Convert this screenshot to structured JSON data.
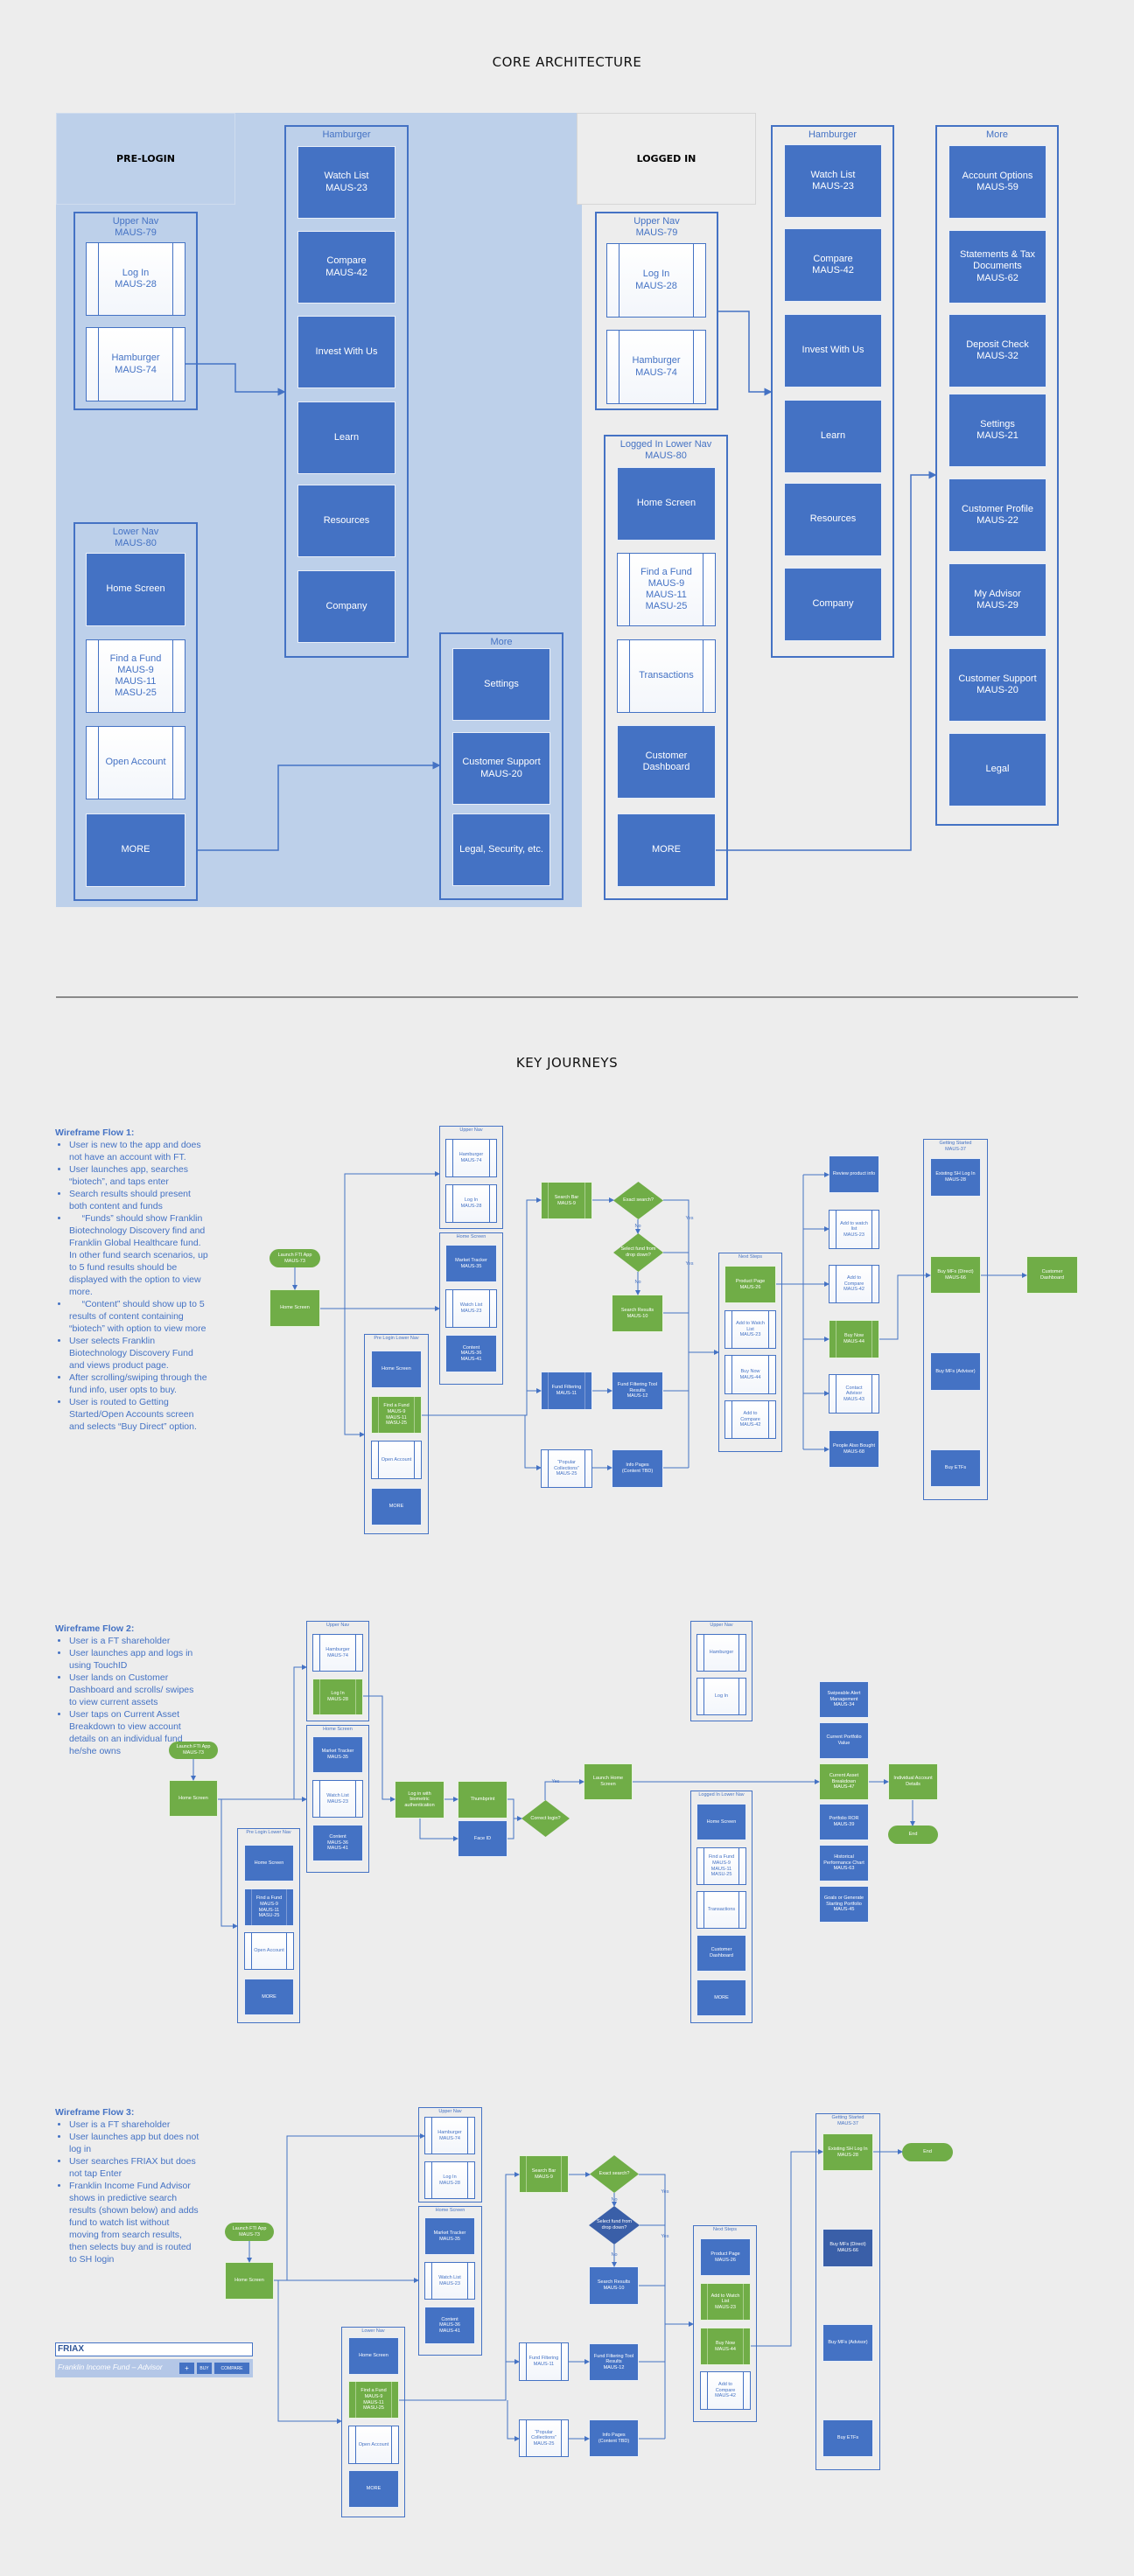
{
  "core": {
    "title": "CORE ARCHITECTURE",
    "pre_login": {
      "title": "PRE-LOGIN",
      "upper_nav": "Upper Nav\nMAUS-79",
      "log_in": "Log In\nMAUS-28",
      "hamburger_nav": "Hamburger\nMAUS-74",
      "hamburger": "Hamburger",
      "watch_list": "Watch List\nMAUS-23",
      "compare": "Compare\nMAUS-42",
      "invest": "Invest With Us",
      "learn": "Learn",
      "resources": "Resources",
      "company": "Company",
      "lower_nav": "Lower Nav\nMAUS-80",
      "home": "Home Screen",
      "find_fund": "Find a Fund\nMAUS-9\nMAUS-11\nMASU-25",
      "open_account": "Open Account",
      "more_btn": "MORE",
      "more": "More",
      "settings": "Settings",
      "support": "Customer Support\nMAUS-20",
      "legal": "Legal, Security, etc."
    },
    "logged_in": {
      "title": "LOGGED IN",
      "upper_nav": "Upper Nav\nMAUS-79",
      "log_in": "Log In\nMAUS-28",
      "hamburger_nav": "Hamburger\nMAUS-74",
      "lower_nav": "Logged In Lower Nav\nMAUS-80",
      "home": "Home Screen",
      "find_fund": "Find a Fund\nMAUS-9\nMAUS-11\nMASU-25",
      "transactions": "Transactions",
      "dashboard": "Customer\nDashboard",
      "more_btn": "MORE",
      "hamburger": "Hamburger",
      "watch_list": "Watch List\nMAUS-23",
      "compare": "Compare\nMAUS-42",
      "invest": "Invest With Us",
      "learn": "Learn",
      "resources": "Resources",
      "company": "Company",
      "more": "More",
      "account_options": "Account Options\nMAUS-59",
      "statements": "Statements & Tax\nDocuments\nMAUS-62",
      "deposit": "Deposit Check\nMAUS-32",
      "settings": "Settings\nMAUS-21",
      "profile": "Customer Profile\nMAUS-22",
      "advisor": "My Advisor\nMAUS-29",
      "support": "Customer Support\nMAUS-20",
      "legal": "Legal"
    }
  },
  "journeys": {
    "title": "KEY JOURNEYS",
    "flow1": {
      "heading": "Wireframe Flow 1:",
      "bullets": [
        "User is new to the app and does not have an account with FT.",
        "User launches app, searches “biotech”, and taps enter",
        "Search results should present both content and funds",
        "     “Funds” should show Franklin Biotechnology Discovery find and Franklin Global Healthcare fund.  In other fund search scenarios, up to 5 fund results should be displayed with the option to view more.",
        "     “Content” should show up to 5 results of content containing “biotech” with option to view more",
        "User selects Franklin Biotechnology Discovery Fund and views product page.",
        "After scrolling/swiping through the fund info, user opts to buy.",
        "User is routed to Getting Started/Open Accounts screen and selects “Buy Direct” option."
      ],
      "nodes": {
        "launch": "Launch FTI App\nMAUS-73",
        "home": "Home Screen",
        "upper_nav": "Upper Nav",
        "hamburger": "Hamburger\nMAUS-74",
        "log_in": "Log In\nMAUS-28",
        "home_group": "Home Screen",
        "market_tracker": "Market Tracker\nMAUS-35",
        "watch_list": "Watch List\nMAUS-23",
        "content": "Content\nMAUS-36\nMAUS-41",
        "lower_nav": "Pre Login Lower Nav",
        "lower_home": "Home Screen",
        "find_fund": "Find a Fund\nMAUS-9\nMAUS-11\nMASU-25",
        "open_account": "Open Account",
        "more": "MORE",
        "search_bar": "Search Bar\nMAUS-9",
        "exact": "Exact search?",
        "no1": "No",
        "select": "Select fund from\ndrop down?",
        "no2": "No",
        "search_results": "Search Results\nMAUS-10",
        "fund_filtering": "Fund Filtering\nMAUS-11",
        "fund_filtering_results": "Fund Filtering Tool\nResults\nMAUS-12",
        "popular": "“Popular\nCollections”\nMAUS-25",
        "info_pages": "Info Pages\n(Content TBD)",
        "yes1": "Yes",
        "yes2": "Yes",
        "next_steps": "Next Steps",
        "product_page": "Product Page\nMAUS-26",
        "ns_watch": "Add to Watch\nList\nMAUS-23",
        "ns_buy": "Buy Now\nMAUS-44",
        "ns_compare": "Add to\nCompare\nMAUS-42",
        "review": "Review product info",
        "add_watch": "Add to watch\nlist\nMAUS-23",
        "add_compare": "Add to\nCompare\nMAUS-42",
        "buy_now": "Buy Now\nMAUS-44",
        "contact_advisor": "Contact\nAdvisor\nMAUS-43",
        "people_bought": "People Also Bought\nMAUS-68",
        "getting_started": "Getting Started\nMAUS-37",
        "existing_login": "Existing SH Log In\nMAUS-28",
        "buy_direct": "Buy MFs (Direct)\nMAUS-66",
        "buy_advisor": "Buy MFs (Advisor)",
        "buy_etfs": "Buy ETFs",
        "dashboard": "Customer\nDashboard"
      }
    },
    "flow2": {
      "heading": "Wireframe Flow 2:",
      "bullets": [
        "User is a FT shareholder",
        "User launches app and logs in using TouchID",
        "User lands on Customer Dashboard and scrolls/ swipes to view current assets",
        "User taps on Current Asset Breakdown to view account details on an individual fund he/she owns"
      ],
      "nodes": {
        "launch": "Launch FTI App\nMAUS-73",
        "home": "Home Screen",
        "upper_nav": "Upper Nav",
        "hamburger": "Hamburger\nMAUS-74",
        "log_in": "Log In\nMAUS-28",
        "home_group": "Home Screen",
        "market_tracker": "Market Tracker\nMAUS-35",
        "watch_list": "Watch List\nMAUS-23",
        "content": "Content\nMAUS-36\nMAUS-41",
        "lower_nav": "Pre Login Lower Nav",
        "lower_home": "Home Screen",
        "find_fund": "Find a Fund\nMAUS-9\nMAUS-11\nMASU-25",
        "open_account": "Open Account",
        "more": "MORE",
        "biometric": "Log in with\nbiometric\nauthentication",
        "thumbprint": "Thumbprint",
        "face_id": "Face ID",
        "correct_login": "Correct login?",
        "yes": "Yes",
        "launch_home": "Launch Home\nScreen",
        "li_upper_nav": "Upper Nav",
        "li_hamburger": "Hamburger",
        "li_log_in": "Log In",
        "li_lower_nav": "Logged In Lower Nav",
        "li_home": "Home Screen",
        "li_find_fund": "Find a Fund\nMAUS-9\nMAUS-11\nMASU-25",
        "li_transactions": "Transactions",
        "li_dashboard": "Customer\nDashboard",
        "li_more": "MORE",
        "swipeable": "Swipeable Alert\nManagement\nMAUS-34",
        "portfolio_value": "Current Portfolio\nValue",
        "asset_breakdown": "Current Asset\nBreakdown\nMAUS-47",
        "portfolio_ror": "Portfolio ROR\nMAUS-39",
        "historical": "Historical\nPerformance Chart\nMAUS-63",
        "goals": "Goals or Generate\nStarting Portfolio\nMAUS-45",
        "account_details": "Individual Account\nDetails",
        "end": "End"
      }
    },
    "flow3": {
      "heading": "Wireframe Flow 3:",
      "bullets": [
        "User is a FT shareholder",
        "User launches app but does not log in",
        "User searches FRIAX but does not tap Enter",
        "Franklin Income Fund Advisor shows in predictive search results (shown below) and adds fund to watch list without moving from search results, then selects buy and is routed to SH login"
      ],
      "search_widget": {
        "query": "FRIAX",
        "result": "Franklin Income Fund – Advisor",
        "add_label": "+",
        "buy_label": "BUY",
        "compare_label": "COMPARE"
      },
      "nodes": {
        "launch": "Launch FTI App\nMAUS-73",
        "home": "Home Screen",
        "upper_nav": "Upper Nav",
        "hamburger": "Hamburger\nMAUS-74",
        "log_in": "Log In\nMAUS-28",
        "home_group": "Home Screen",
        "market_tracker": "Market Tracker\nMAUS-35",
        "watch_list": "Watch List\nMAUS-23",
        "content": "Content\nMAUS-36\nMAUS-41",
        "lower_nav": "Lower Nav",
        "lower_home": "Home Screen",
        "find_fund": "Find a Fund\nMAUS-9\nMAUS-11\nMASU-25",
        "open_account": "Open Account",
        "more": "MORE",
        "search_bar": "Search Bar\nMAUS-9",
        "exact": "Exact search?",
        "no1": "No",
        "select": "Select fund from\ndrop down?",
        "no2": "No",
        "search_results": "Search Results\nMAUS-10",
        "fund_filtering": "Fund Filtering\nMAUS-11",
        "fund_filtering_results": "Fund Filtering Tool\nResults\nMAUS-12",
        "popular": "“Popular\nCollections”\nMAUS-25",
        "info_pages": "Info Pages\n(Content TBD)",
        "yes1": "Yes",
        "yes2": "Yes",
        "next_steps": "Next Steps",
        "product_page": "Product Page\nMAUS-26",
        "ns_watch": "Add to Watch\nList\nMAUS-23",
        "ns_buy": "Buy Now\nMAUS-44",
        "ns_compare": "Add to\nCompare\nMAUS-42",
        "getting_started": "Getting Started\nMAUS-37",
        "existing_login": "Existing SH Log In\nMAUS-28",
        "buy_direct": "Buy MFs (Direct)\nMAUS-66",
        "buy_advisor": "Buy MFs (Advisor)",
        "buy_etfs": "Buy ETFs",
        "end": "End"
      }
    }
  },
  "colors": {
    "blue": "#4472c4",
    "dark_blue": "#3a5fa8",
    "green": "#70ad47",
    "pre_login_region": "#bdd0ea",
    "background": "#ededed"
  }
}
